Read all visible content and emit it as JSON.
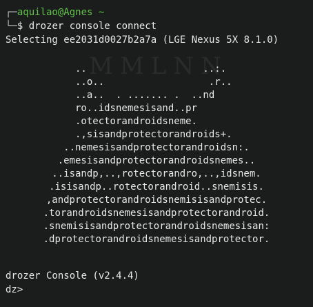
{
  "prompt": {
    "corner": "┌─",
    "user_host": "aquilao@Agnes",
    "path": "~",
    "branch": "└─",
    "dollar": "$",
    "command": "drozer console connect"
  },
  "output": {
    "selecting": "Selecting ee2031d0027b2a7a (LGE Nexus 5X 8.1.0)"
  },
  "ascii_art": [
    "..                    ..:.  ",
    "..o..                  .r.. ",
    "..a..  . ....... .  ..nd    ",
    "ro..idsnemesisand..pr       ",
    ".otectorandroidsneme.       ",
    ".,sisandprotectorandroids+. ",
    "..nemesisandprotectorandroidsn:.",
    ".emesisandprotectorandroidsnemes..",
    "..isandp,..,rotectorandro,..,idsnem.",
    ".isisandp..rotectorandroid..snemisis.",
    ",andprotectorandroidsnemisisandprotec.",
    ".torandroidsnemesisandprotectorandroid.",
    ".snemisisandprotectorandroidsnemesisan:",
    ".dprotectorandroidsnemesisandprotector."
  ],
  "footer": {
    "version": "drozer Console (v2.4.4)",
    "prompt": "dz>"
  },
  "watermark": "MMLNN",
  "colors": {
    "background": "#1b1d1d",
    "text": "#e8e8e8",
    "accent": "#63c34a"
  }
}
